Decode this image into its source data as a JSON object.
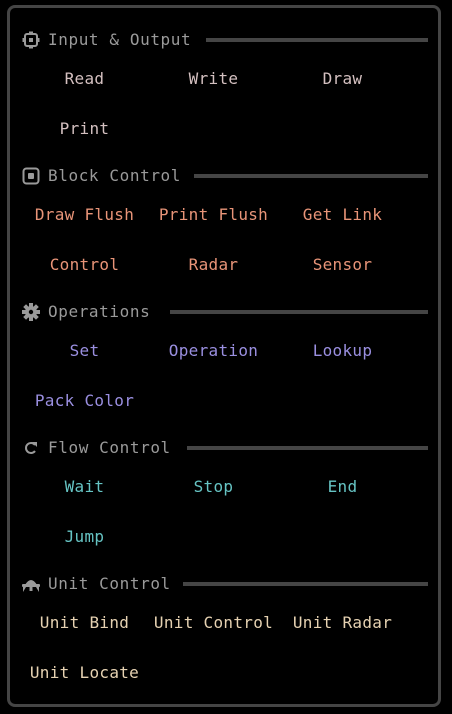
{
  "sections": [
    {
      "title": "Input & Output",
      "icon": "gear-icon",
      "color": "#d4c0c0",
      "items": [
        "Read",
        "Write",
        "Draw",
        "Print"
      ]
    },
    {
      "title": "Block Control",
      "icon": "block-icon",
      "color": "#e89478",
      "items": [
        "Draw Flush",
        "Print Flush",
        "Get Link",
        "Control",
        "Radar",
        "Sensor"
      ]
    },
    {
      "title": "Operations",
      "icon": "cog-icon",
      "color": "#9a8fe0",
      "items": [
        "Set",
        "Operation",
        "Lookup",
        "Pack Color"
      ]
    },
    {
      "title": "Flow Control",
      "icon": "refresh-icon",
      "color": "#66c4c4",
      "items": [
        "Wait",
        "Stop",
        "End",
        "Jump"
      ]
    },
    {
      "title": "Unit Control",
      "icon": "unit-icon",
      "color": "#e6d2b2",
      "items": [
        "Unit Bind",
        "Unit Control",
        "Unit Radar",
        "Unit Locate"
      ]
    }
  ]
}
